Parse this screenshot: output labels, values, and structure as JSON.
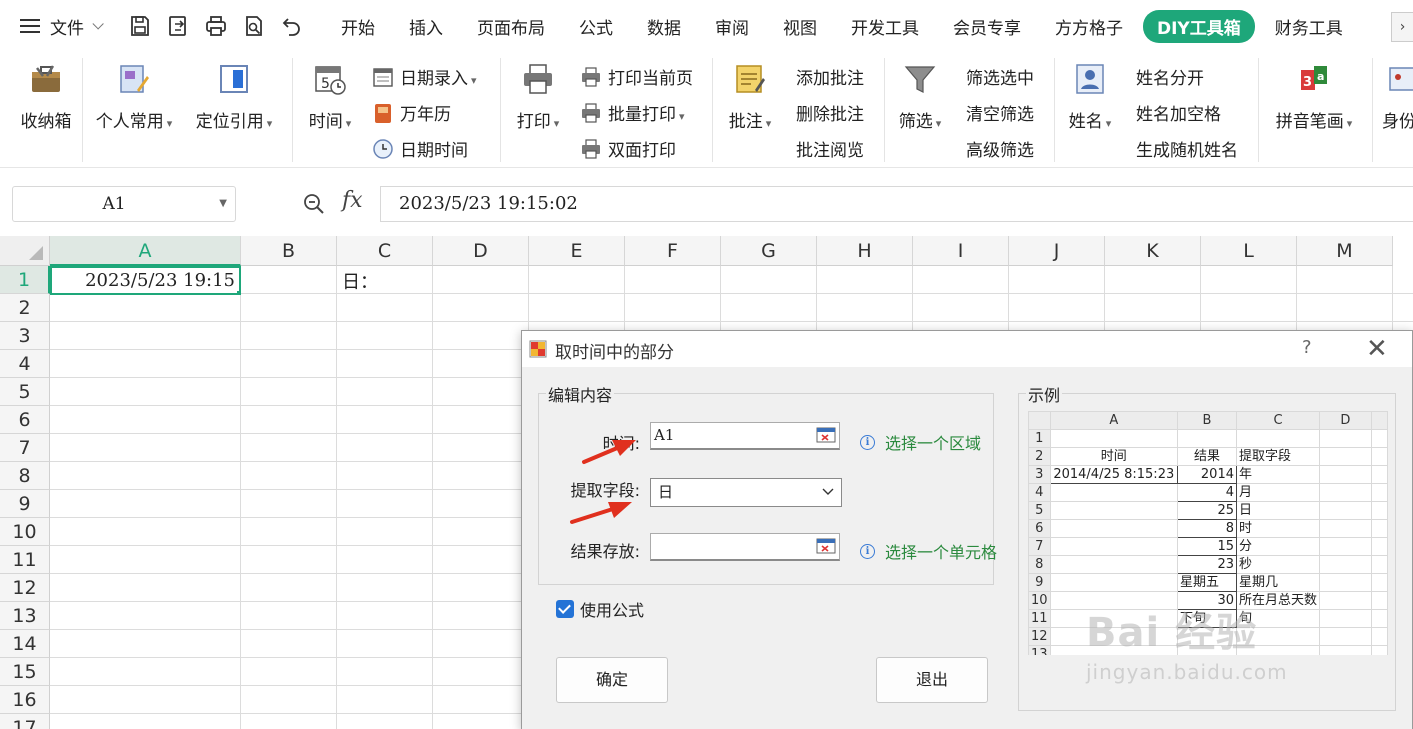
{
  "menubar": {
    "file_label": "文件",
    "tabs": [
      "开始",
      "插入",
      "页面布局",
      "公式",
      "数据",
      "审阅",
      "视图",
      "开发工具",
      "会员专享",
      "方方格子",
      "DIY工具箱",
      "财务工具"
    ],
    "active_tab": "DIY工具箱",
    "active_tab_color": "#1ea77a",
    "more": "›"
  },
  "ribbon": {
    "storage": "收纳箱",
    "personal": "个人常用",
    "locate": "定位引用",
    "time": "时间",
    "date_entry": "日期录入",
    "calendar": "万年历",
    "date_time": "日期时间",
    "print": "打印",
    "print_current": "打印当前页",
    "batch_print": "批量打印",
    "duplex_print": "双面打印",
    "comment": "批注",
    "add_comment": "添加批注",
    "delete_comment": "删除批注",
    "read_comment": "批注阅览",
    "filter": "筛选",
    "filter_selected": "筛选选中",
    "clear_filter": "清空筛选",
    "advanced_filter": "高级筛选",
    "name": "姓名",
    "split_name": "姓名分开",
    "name_space": "姓名加空格",
    "random_name": "生成随机姓名",
    "pinyin": "拼音笔画",
    "id_partial": "身份"
  },
  "formula_bar": {
    "cell_ref": "A1",
    "fx": "fx",
    "value": "2023/5/23  19:15:02"
  },
  "sheet": {
    "columns": [
      "A",
      "B",
      "C",
      "D",
      "E",
      "F",
      "G",
      "H",
      "I",
      "J",
      "K",
      "L",
      "M"
    ],
    "rows": [
      "1",
      "2",
      "3",
      "4",
      "5",
      "6",
      "7",
      "8",
      "9",
      "10",
      "11",
      "12",
      "13",
      "14",
      "15",
      "16",
      "17"
    ],
    "a1": "2023/5/23  19:15",
    "c1": "日："
  },
  "dialog": {
    "title": "取时间中的部分",
    "help": "?",
    "close": "✕",
    "edit_group": "编辑内容",
    "time_label": "时间:",
    "time_value": "A1",
    "time_hint": "选择一个区域",
    "field_label": "提取字段:",
    "field_value": "日",
    "result_label": "结果存放:",
    "result_value": "",
    "result_hint": "选择一个单元格",
    "use_formula": "使用公式",
    "ok": "确定",
    "exit": "退出",
    "example_group": "示例",
    "example": {
      "cols": [
        "A",
        "B",
        "C",
        "D"
      ],
      "rows": [
        [
          "1",
          "",
          "",
          "",
          ""
        ],
        [
          "2",
          "时间",
          "结果",
          "提取字段",
          ""
        ],
        [
          "3",
          "2014/4/25 8:15:23",
          "2014",
          "年",
          ""
        ],
        [
          "4",
          "",
          "4",
          "月",
          ""
        ],
        [
          "5",
          "",
          "25",
          "日",
          ""
        ],
        [
          "6",
          "",
          "8",
          "时",
          ""
        ],
        [
          "7",
          "",
          "15",
          "分",
          ""
        ],
        [
          "8",
          "",
          "23",
          "秒",
          ""
        ],
        [
          "9",
          "",
          "星期五",
          "星期几",
          ""
        ],
        [
          "10",
          "",
          "30",
          "所在月总天数",
          ""
        ],
        [
          "11",
          "",
          "下旬",
          "旬",
          ""
        ],
        [
          "12",
          "",
          "",
          "",
          ""
        ],
        [
          "13",
          "",
          "",
          "",
          ""
        ]
      ]
    }
  },
  "watermark": {
    "brand": "Bai 经验",
    "url": "jingyan.baidu.com"
  }
}
